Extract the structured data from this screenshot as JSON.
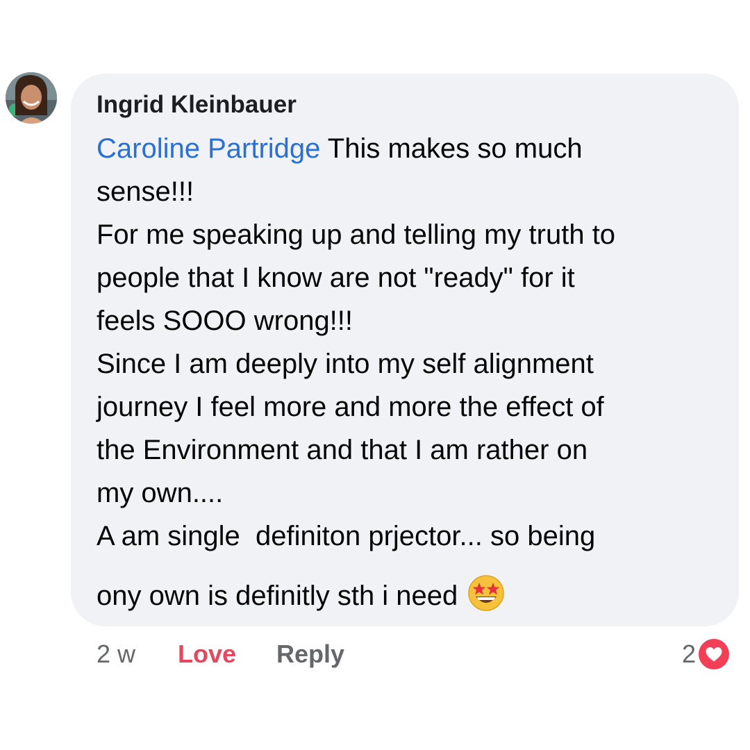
{
  "comment": {
    "author": "Ingrid Kleinbauer",
    "mention": "Caroline Partridge",
    "lines": [
      " This makes so much",
      "sense!!!",
      "For me speaking up and telling my truth to",
      "people that I know are not \"ready\" for it",
      "feels SOOO wrong!!!",
      "Since I am deeply into my self alignment",
      "journey I feel more and more the effect of",
      "the Environment and that I am rather on",
      "my own....",
      "A am single  definiton prjector... so being",
      "ony own is definitly sth i need"
    ],
    "emoji": "star-struck-emoji"
  },
  "actions": {
    "time": "2 w",
    "love_label": "Love",
    "reply_label": "Reply"
  },
  "reactions": {
    "count": "2",
    "icon": "heart-icon"
  },
  "colors": {
    "bubble": "#f0f2f5",
    "mention": "#2a6fd6",
    "love": "#e8455e",
    "heart_badge": "#f33e58",
    "muted_text": "#65676b"
  }
}
